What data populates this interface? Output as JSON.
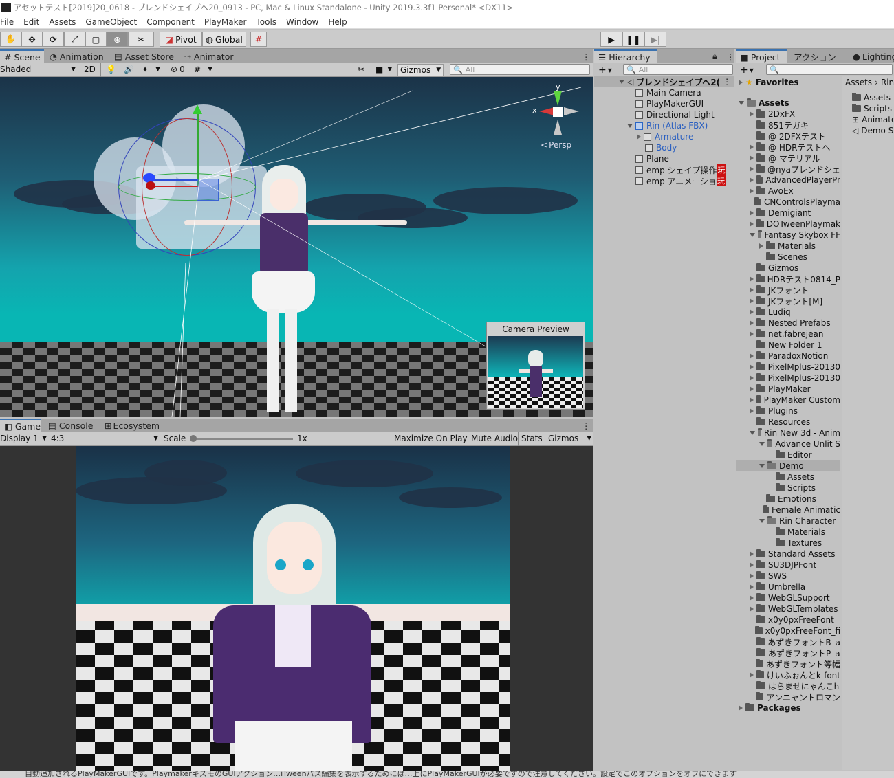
{
  "titlebar": {
    "title": "アセットテスト[2019]20_0618 - ブレンドシェイプへ20_0913 - PC, Mac & Linux Standalone - Unity 2019.3.3f1 Personal* <DX11>"
  },
  "menu": [
    "File",
    "Edit",
    "Assets",
    "GameObject",
    "Component",
    "PlayMaker",
    "Tools",
    "Window",
    "Help"
  ],
  "toolbar": {
    "pivot": "Pivot",
    "global": "Global"
  },
  "scene_tabs": {
    "scene": "Scene",
    "animation": "Animation",
    "asset_store": "Asset Store",
    "animator": "Animator"
  },
  "scene_toolbar": {
    "shading": "Shaded",
    "mode_2d": "2D",
    "hidden_count": "0",
    "gizmos": "Gizmos",
    "search_placeholder": "All"
  },
  "scene_view": {
    "persp_label": "Persp",
    "axis_x": "x",
    "axis_y": "y",
    "camera_preview_title": "Camera Preview"
  },
  "game_tabs": {
    "game": "Game",
    "console": "Console",
    "ecosystem": "Ecosystem"
  },
  "game_toolbar": {
    "display": "Display 1",
    "aspect": "4:3",
    "scale_label": "Scale",
    "scale_value": "1x",
    "maximize": "Maximize On Play",
    "mute": "Mute Audio",
    "stats": "Stats",
    "gizmos": "Gizmos"
  },
  "hierarchy": {
    "tab": "Hierarchy",
    "search_placeholder": "All",
    "scene_name": "ブレンドシェイプへ2(",
    "items": [
      {
        "label": "Main Camera"
      },
      {
        "label": "PlayMakerGUI"
      },
      {
        "label": "Directional Light"
      },
      {
        "label": "Rin (Atlas FBX)"
      },
      {
        "label": "Armature"
      },
      {
        "label": "Body"
      },
      {
        "label": "Plane"
      },
      {
        "label": "emp シェイプ操作"
      },
      {
        "label": "emp アニメーショ"
      }
    ],
    "badge": "玩"
  },
  "project": {
    "tab": "Project",
    "tab2": "アクション",
    "tab3": "Lighting",
    "favorites": "Favorites",
    "assets": "Assets",
    "packages": "Packages",
    "folders": [
      "2DxFX",
      "851テガキ",
      "@ 2DFXテスト",
      "@ HDRテストへ",
      "@ マテリアル",
      "@nyaブレンドシェ",
      "AdvancedPlayerPr",
      "AvoEx",
      "CNControlsPlayma",
      "Demigiant",
      "DOTweenPlaymak",
      "Fantasy Skybox FF",
      "Materials",
      "Scenes",
      "Gizmos",
      "HDRテスト0814_P",
      "JKフォント",
      "JKフォント[M]",
      "Ludiq",
      "Nested Prefabs",
      "net.fabrejean",
      "New Folder 1",
      "ParadoxNotion",
      "PixelMplus-20130",
      "PixelMplus-20130",
      "PlayMaker",
      "PlayMaker Custom",
      "Plugins",
      "Resources",
      "Rin New 3d - Anim",
      "Advance Unlit S",
      "Editor",
      "Demo",
      "Assets",
      "Scripts",
      "Emotions",
      "Female Animatic",
      "Rin Character",
      "Materials",
      "Textures",
      "Standard Assets",
      "SU3DJPFont",
      "SWS",
      "Umbrella",
      "WebGLSupport",
      "WebGLTemplates",
      "x0y0pxFreeFont",
      "x0y0pxFreeFont_fi",
      "あずきフォントB_a",
      "あずきフォントP_a",
      "あずきフォント等幅",
      "けいふぉんとk-font",
      "はらませにゃんこh",
      "アンニャントロマン"
    ],
    "breadcrumb": [
      "Assets",
      "Rin"
    ],
    "right_items": [
      "Assets",
      "Scripts",
      "Animato",
      "Demo S"
    ]
  },
  "colors": {
    "accent": "#3a72b0",
    "sky": "#08b6b4",
    "panel": "#c2c2c2"
  },
  "status": {
    "text": "自動追加されるPlayMakerGUIです。PlaymakerギズモのGUIアクション…iTweenパス編集を表示するためには…上にPlayMakerGUIが必要ですので注意してください。設定でこのオプションをオフにできます"
  }
}
